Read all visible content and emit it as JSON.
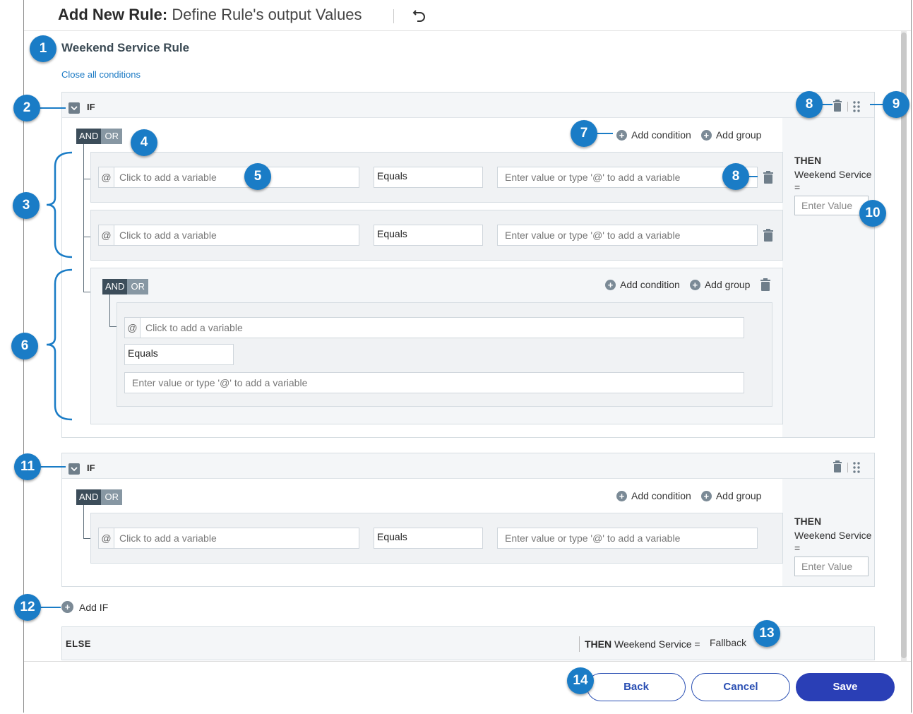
{
  "header": {
    "title_bold": "Add New Rule:",
    "title_sub": "Define Rule's output Values"
  },
  "rule": {
    "name": "Weekend Service Rule",
    "close_all": "Close all conditions"
  },
  "if_label": "IF",
  "and_label": "AND",
  "or_label": "OR",
  "add_condition": "Add condition",
  "add_group": "Add group",
  "variable_placeholder": "Click to add a variable",
  "at_symbol": "@",
  "operator_value": "Equals",
  "value_placeholder": "Enter value or type '@' to add a variable",
  "then": {
    "label": "THEN",
    "target": "Weekend Service",
    "eq": "=",
    "placeholder": "Enter Value"
  },
  "add_if": "Add IF",
  "else": {
    "label": "ELSE",
    "then_label": "THEN",
    "target_eq": "Weekend Service =",
    "value": "Fallback"
  },
  "footer": {
    "back": "Back",
    "cancel": "Cancel",
    "save": "Save"
  },
  "callouts": [
    "1",
    "2",
    "3",
    "4",
    "5",
    "6",
    "7",
    "8",
    "8",
    "9",
    "10",
    "11",
    "12",
    "13",
    "14"
  ],
  "colors": {
    "callout": "#1a7cc6",
    "save_button": "#2a3fb6",
    "and_active": "#3c4d5a",
    "or_inactive": "#8797a3",
    "link": "#1b7ac4"
  }
}
